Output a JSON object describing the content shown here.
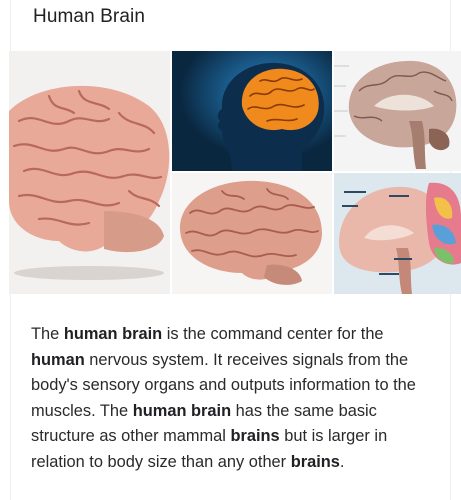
{
  "card": {
    "title": "Human Brain"
  },
  "gallery": {
    "images": [
      {
        "icon": "brain-side-view-image"
      },
      {
        "icon": "glowing-brain-head-silhouette-image"
      },
      {
        "icon": "brain-sagittal-section-image"
      },
      {
        "icon": "brain-3d-model-image"
      },
      {
        "icon": "brain-anatomy-diagram-image"
      }
    ],
    "colors": {
      "brain_pink": "#e8a99a",
      "brain_fold": "#b86a5a",
      "silhouette_blue": "#1b6fb3",
      "glow_orange": "#f08a1c"
    }
  },
  "description": {
    "parts": [
      {
        "text": "The ",
        "bold": false
      },
      {
        "text": "human brain",
        "bold": true
      },
      {
        "text": " is the command center for the ",
        "bold": false
      },
      {
        "text": "human",
        "bold": true
      },
      {
        "text": " nervous system. It receives signals from the body's sensory organs and outputs information to the muscles. The ",
        "bold": false
      },
      {
        "text": "human brain",
        "bold": true
      },
      {
        "text": " has the same basic structure as other mammal ",
        "bold": false
      },
      {
        "text": "brains",
        "bold": true
      },
      {
        "text": " but is larger in relation to body size than any other ",
        "bold": false
      },
      {
        "text": "brains",
        "bold": true
      },
      {
        "text": ".",
        "bold": false
      }
    ]
  }
}
